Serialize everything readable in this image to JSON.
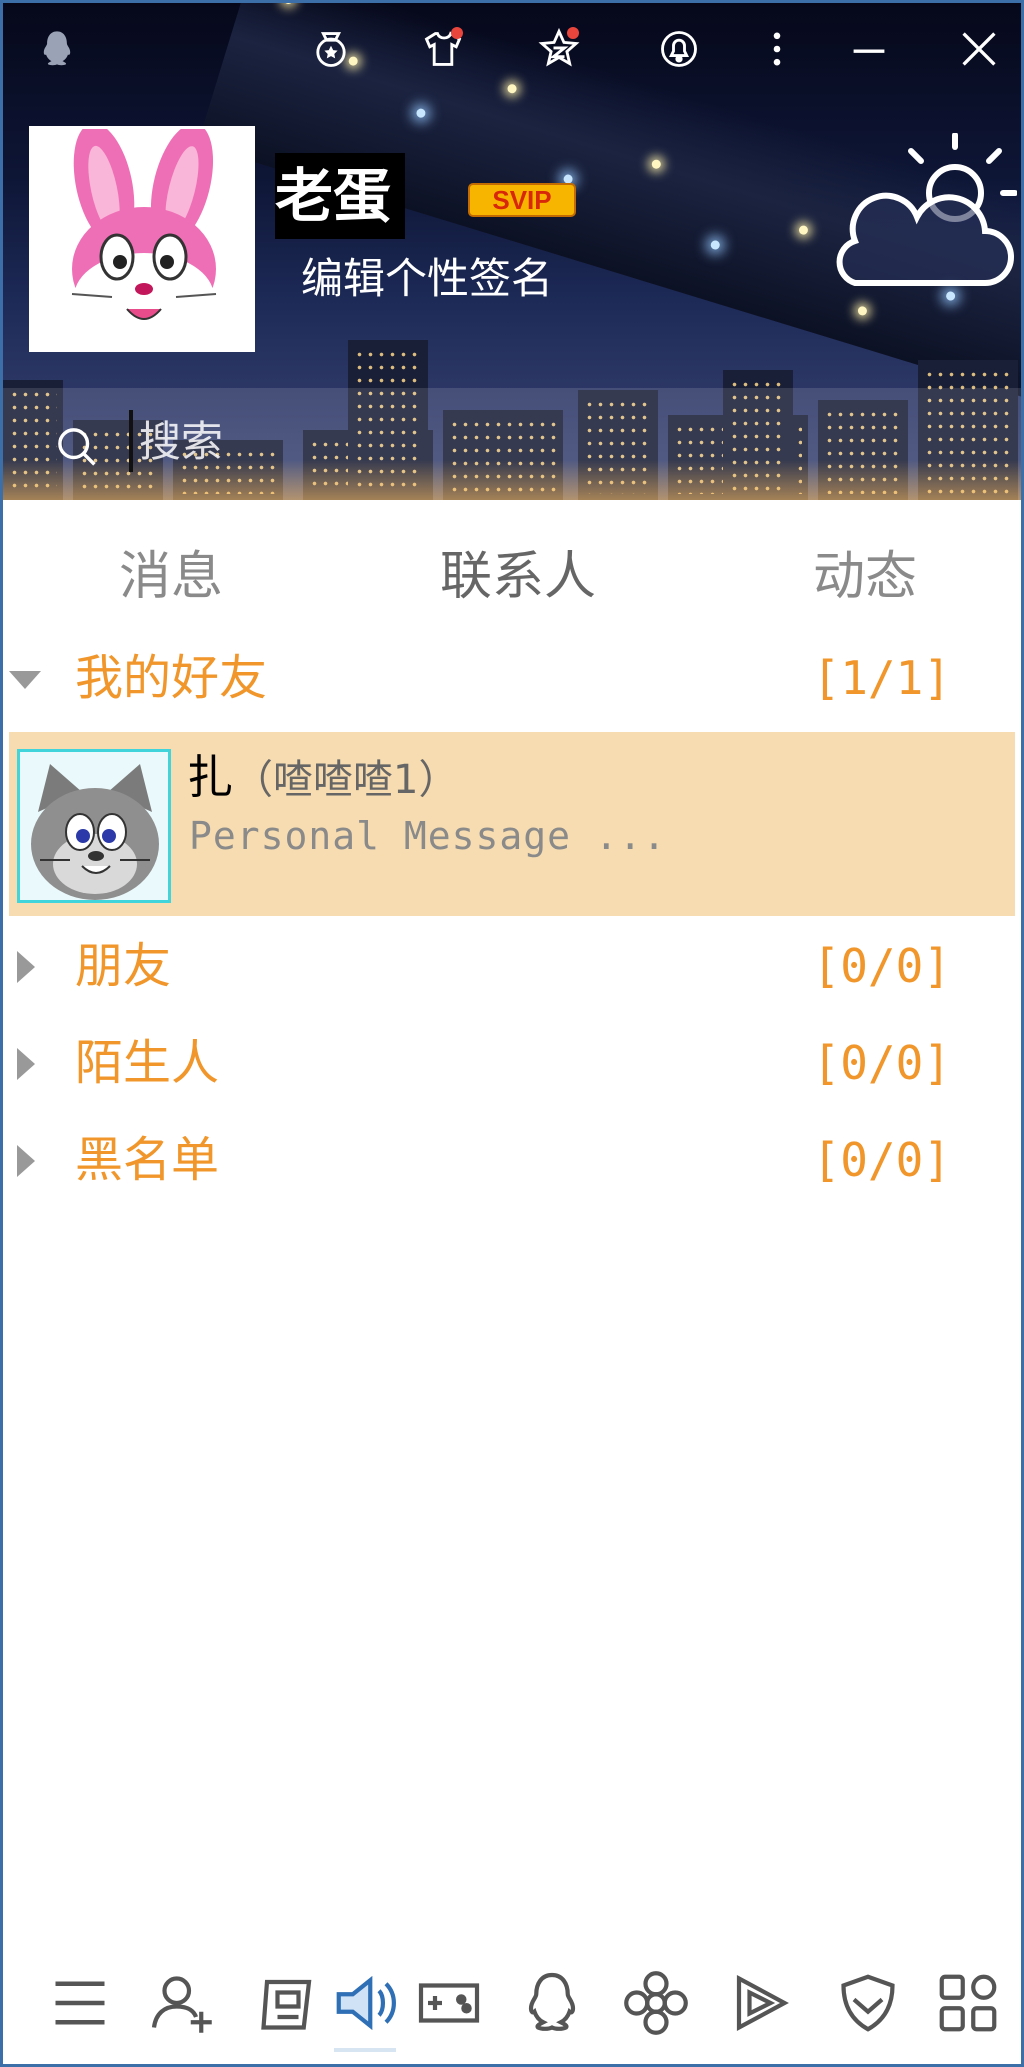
{
  "profile": {
    "nickname": "老蛋",
    "vip_badge": "SVIP",
    "signature": "编辑个性签名"
  },
  "search": {
    "placeholder": "搜索"
  },
  "tabs": [
    {
      "label": "消息",
      "active": false
    },
    {
      "label": "联系人",
      "active": true
    },
    {
      "label": "动态",
      "active": false
    }
  ],
  "groups": [
    {
      "name": "我的好友",
      "count": "[1/1]",
      "expanded": true
    },
    {
      "name": "朋友",
      "count": "[0/0]",
      "expanded": false
    },
    {
      "name": "陌生人",
      "count": "[0/0]",
      "expanded": false
    },
    {
      "name": "黑名单",
      "count": "[0/0]",
      "expanded": false
    }
  ],
  "contact": {
    "name": "扎",
    "remark": "（喳喳喳1）",
    "message": "Personal Message ..."
  },
  "toolbar": [
    {
      "icon": "menu-icon"
    },
    {
      "icon": "add-friend-icon"
    },
    {
      "icon": "game-icon"
    },
    {
      "icon": "speaker-icon",
      "active": true
    },
    {
      "icon": "gamepad-icon"
    },
    {
      "icon": "penguin-icon"
    },
    {
      "icon": "flower-icon"
    },
    {
      "icon": "video-play-icon"
    },
    {
      "icon": "shield-check-icon"
    },
    {
      "icon": "apps-grid-icon"
    }
  ],
  "colors": {
    "group_text": "#f0962a",
    "contact_highlight": "#f6dcb0",
    "avatar_border": "#41d4da",
    "vip_badge": "#f7b500",
    "window_border": "#3c6fa8"
  }
}
